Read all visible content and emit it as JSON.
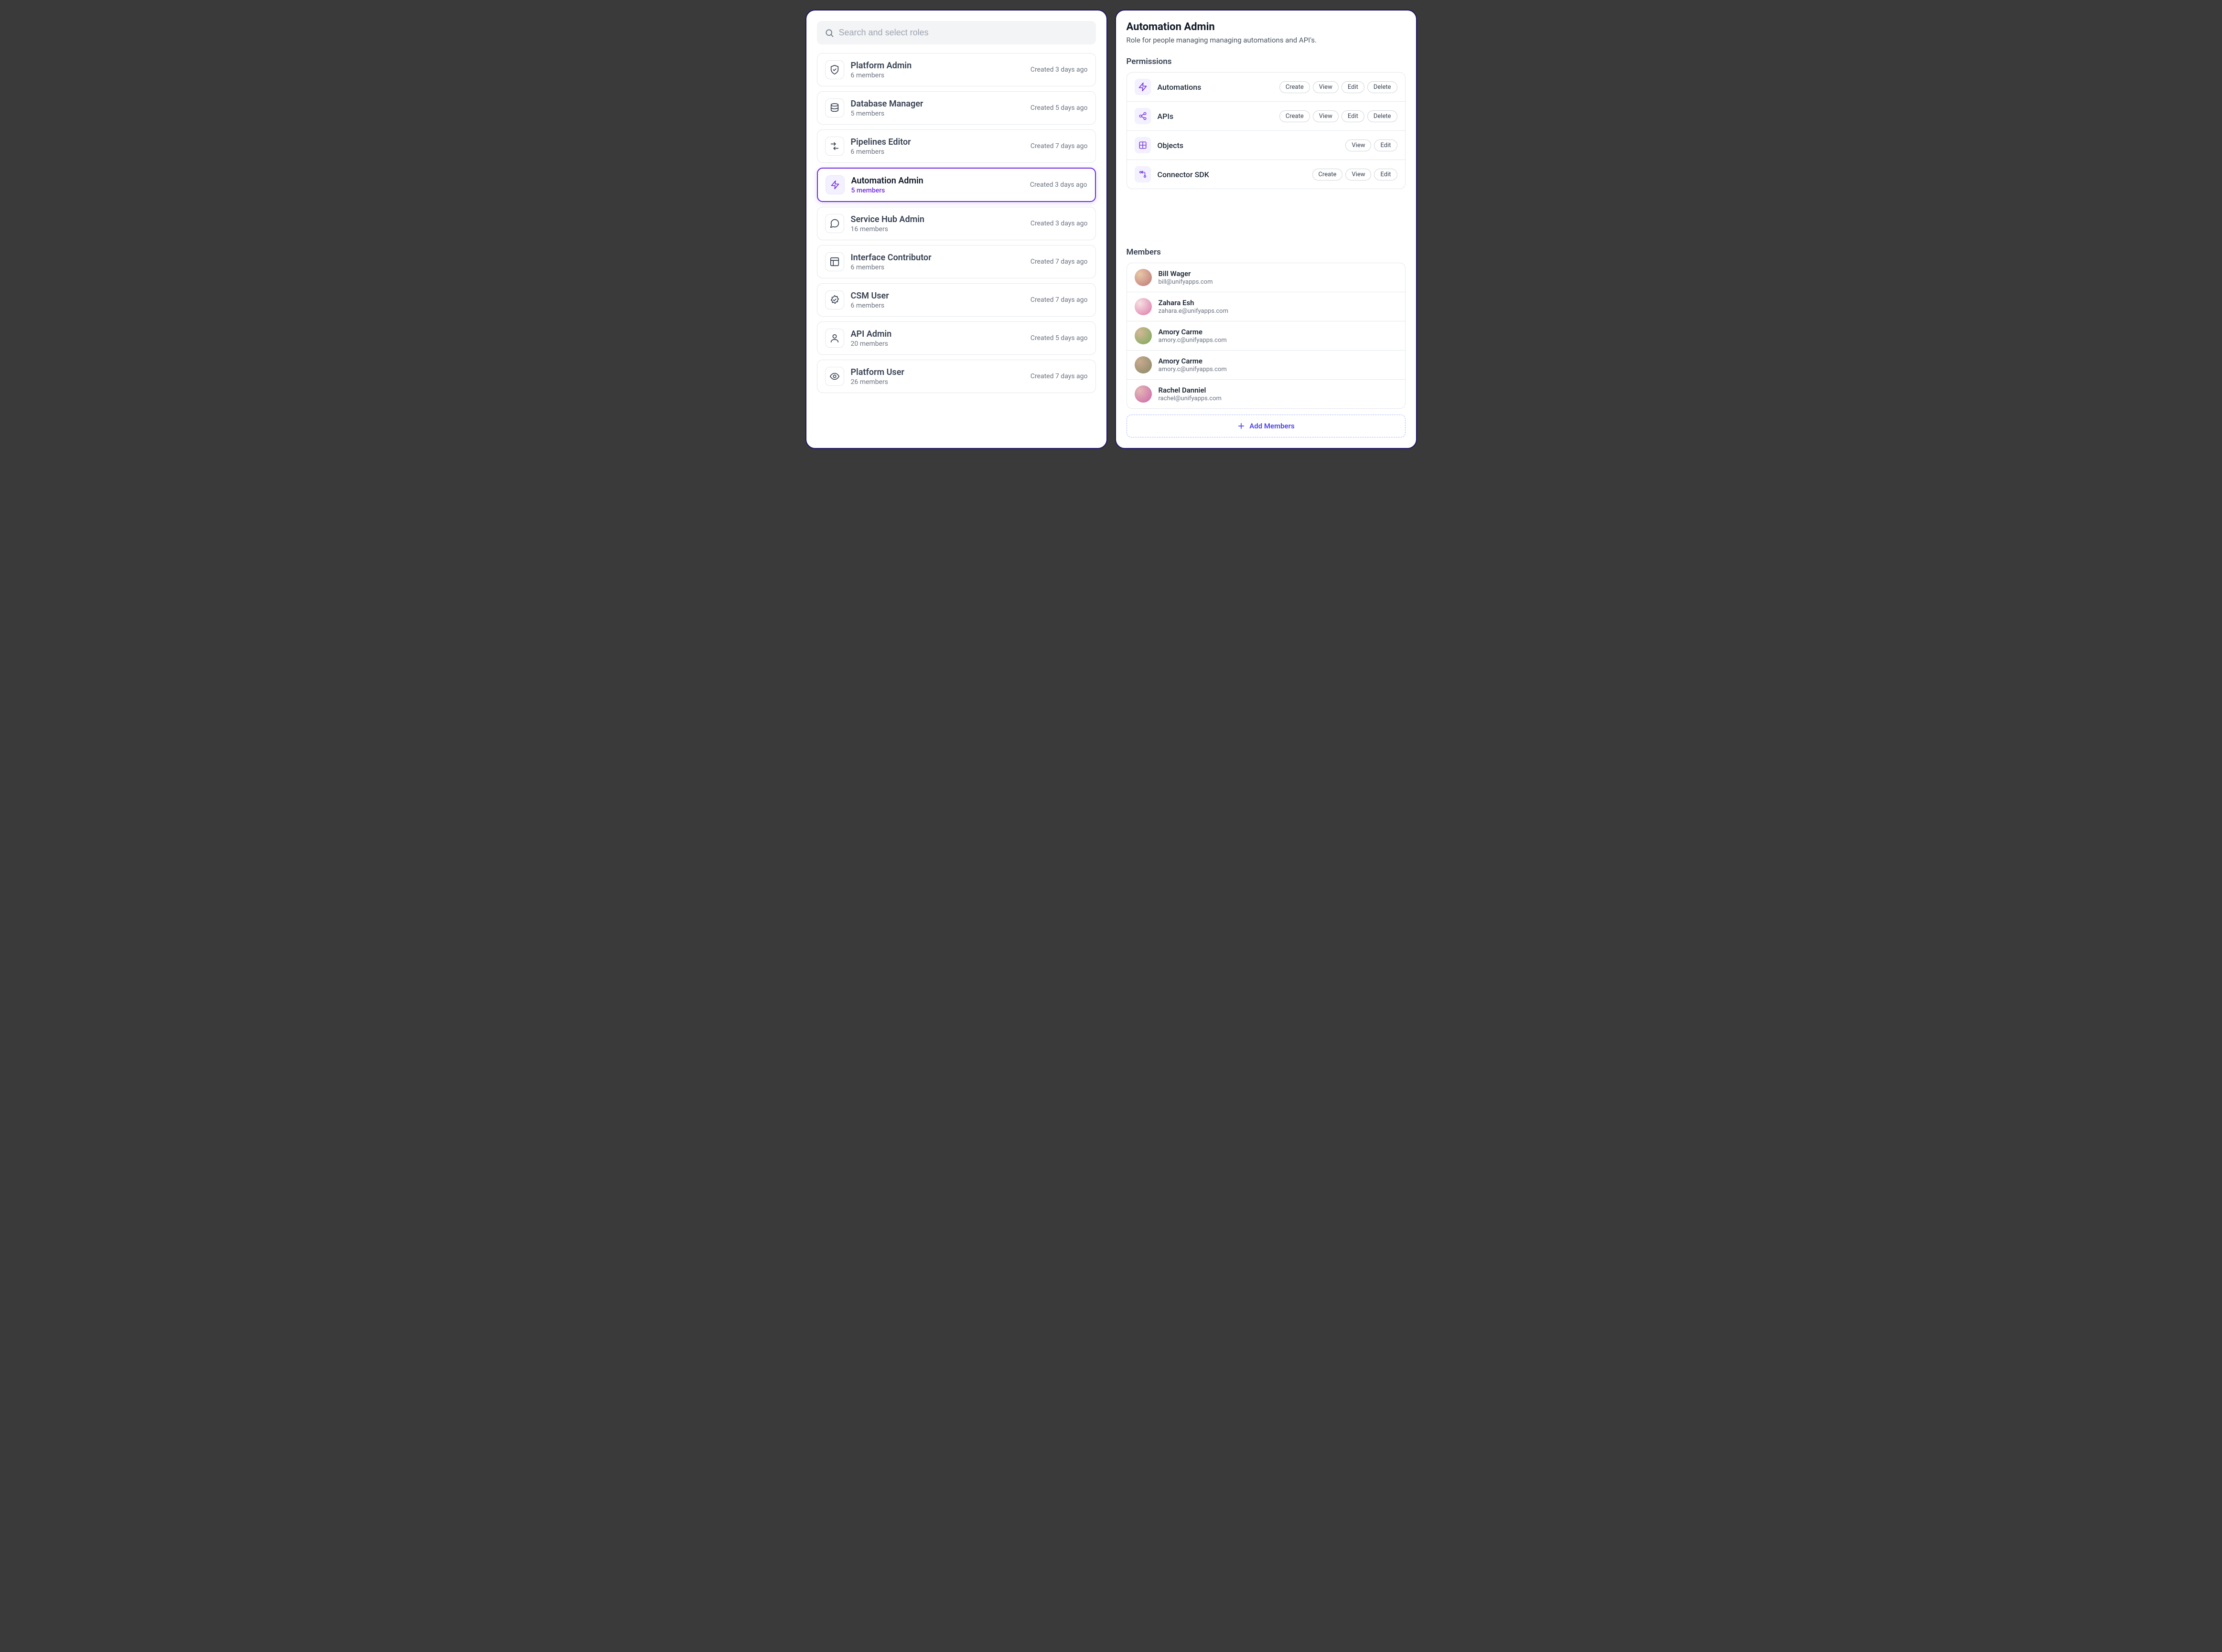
{
  "search": {
    "placeholder": "Search and select roles"
  },
  "roles": [
    {
      "name": "Platform Admin",
      "members": "6 members",
      "created": "Created 3 days ago",
      "icon": "shield",
      "selected": false
    },
    {
      "name": "Database Manager",
      "members": "5 members",
      "created": "Created 5 days ago",
      "icon": "database",
      "selected": false
    },
    {
      "name": "Pipelines Editor",
      "members": "6 members",
      "created": "Created 7 days ago",
      "icon": "pipeline",
      "selected": false
    },
    {
      "name": "Automation Admin",
      "members": "5 members",
      "created": "Created 3 days ago",
      "icon": "bolt",
      "selected": true
    },
    {
      "name": "Service Hub Admin",
      "members": "16 members",
      "created": "Created 3 days ago",
      "icon": "chat",
      "selected": false
    },
    {
      "name": "Interface Contributor",
      "members": "6 members",
      "created": "Created 7 days ago",
      "icon": "layout",
      "selected": false
    },
    {
      "name": "CSM User",
      "members": "6 members",
      "created": "Created 7 days ago",
      "icon": "badge",
      "selected": false
    },
    {
      "name": "API Admin",
      "members": "20 members",
      "created": "Created 5 days ago",
      "icon": "user",
      "selected": false
    },
    {
      "name": "Platform User",
      "members": "26 members",
      "created": "Created 7 days ago",
      "icon": "eye",
      "selected": false
    }
  ],
  "detail": {
    "title": "Automation Admin",
    "description": "Role for people managing managing  automations and API's.",
    "permissions_label": "Permissions",
    "permissions": [
      {
        "name": "Automations",
        "icon": "bolt",
        "actions": [
          "Create",
          "View",
          "Edit",
          "Delete"
        ]
      },
      {
        "name": "APIs",
        "icon": "share",
        "actions": [
          "Create",
          "View",
          "Edit",
          "Delete"
        ]
      },
      {
        "name": "Objects",
        "icon": "grid",
        "actions": [
          "View",
          "Edit"
        ]
      },
      {
        "name": "Connector SDK",
        "icon": "sdk",
        "actions": [
          "Create",
          "View",
          "Edit"
        ]
      }
    ],
    "members_label": "Members",
    "members": [
      {
        "name": "Bill Wager",
        "email": "bill@unifyapps.com",
        "avatar": "a"
      },
      {
        "name": "Zahara Esh",
        "email": "zahara.e@unifyapps.com",
        "avatar": "b"
      },
      {
        "name": "Amory Carme",
        "email": "amory.c@unifyapps.com",
        "avatar": "c"
      },
      {
        "name": "Amory Carme",
        "email": "amory.c@unifyapps.com",
        "avatar": "d"
      },
      {
        "name": "Rachel Danniel",
        "email": "rachel@unifyapps.com",
        "avatar": "e"
      }
    ],
    "add_members_label": "Add Members"
  }
}
